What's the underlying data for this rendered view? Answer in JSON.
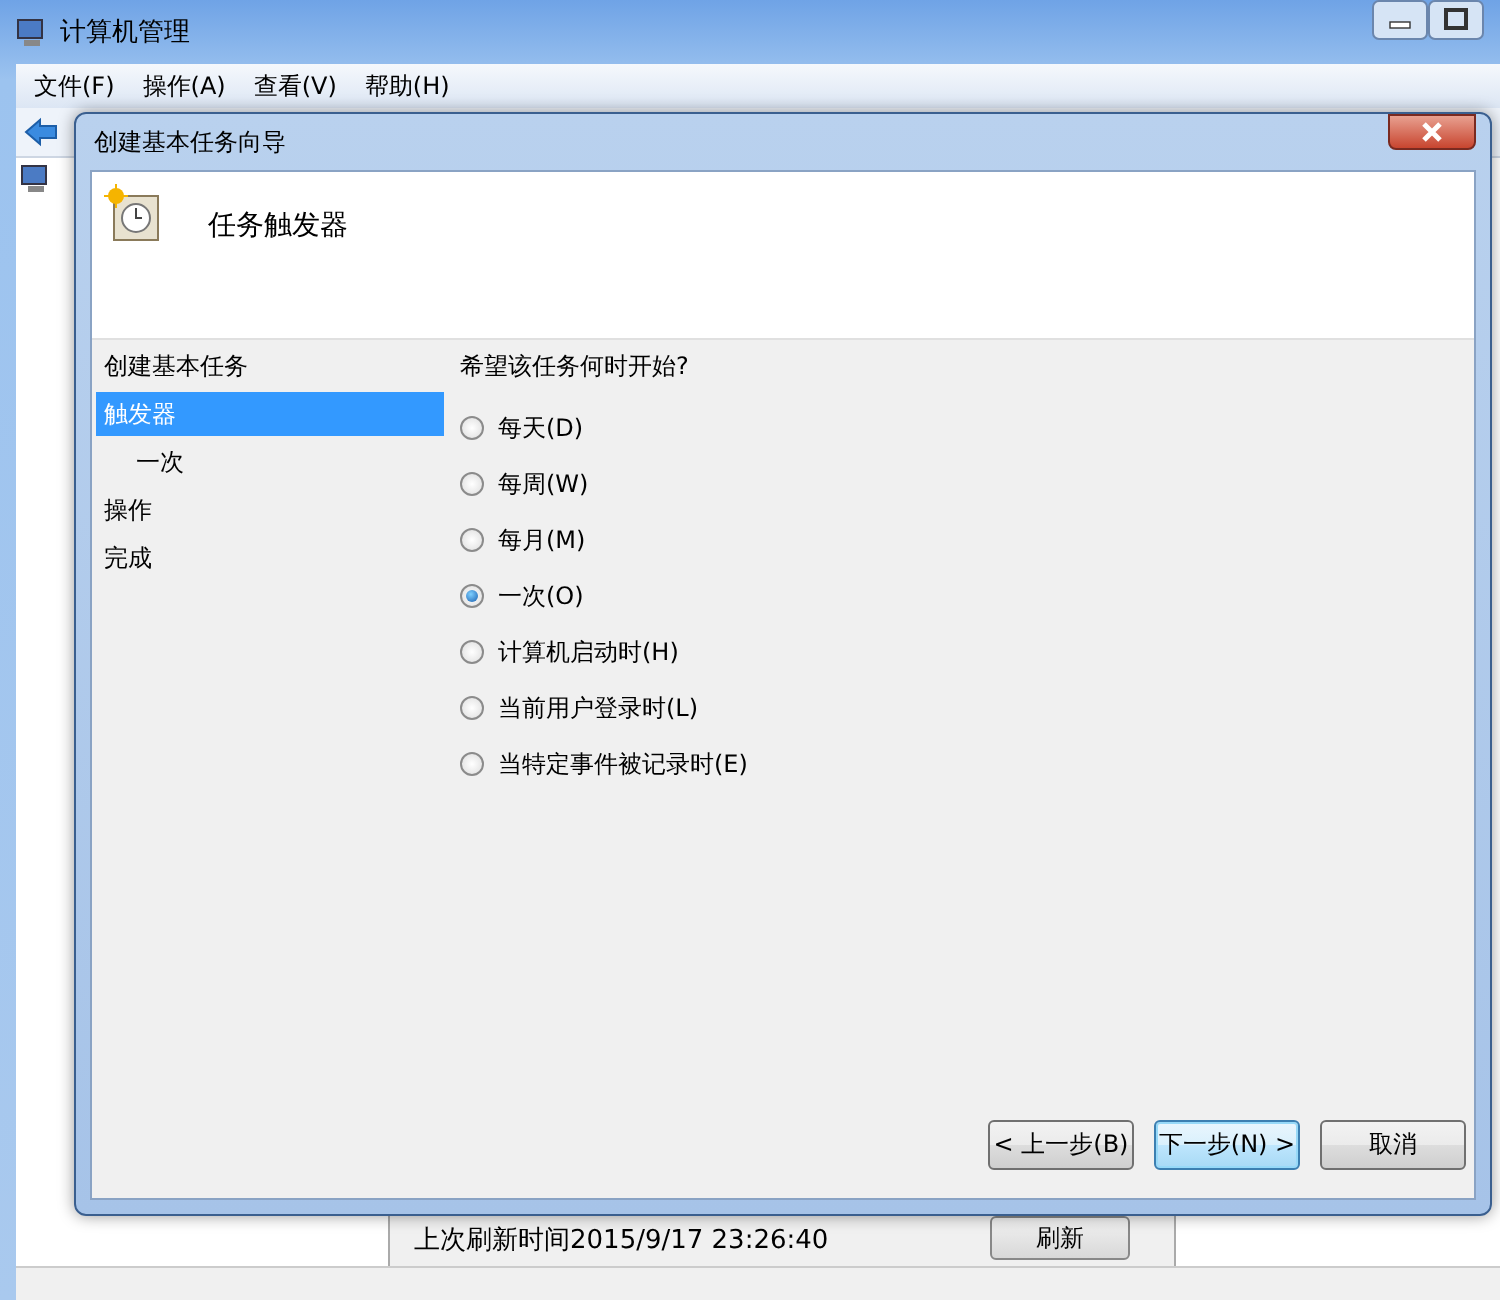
{
  "window": {
    "title": "计算机管理",
    "menu": [
      "文件(F)",
      "操作(A)",
      "查看(V)",
      "帮助(H)"
    ],
    "status_text": "上次刷新时间2015/9/17 23:26:40",
    "refresh_button": "刷新"
  },
  "dialog": {
    "title": "创建基本任务向导",
    "header": "任务触发器",
    "steps": [
      {
        "label": "创建基本任务",
        "selected": false
      },
      {
        "label": "触发器",
        "selected": true,
        "children": [
          {
            "label": "一次",
            "selected": false
          }
        ]
      },
      {
        "label": "操作",
        "selected": false
      },
      {
        "label": "完成",
        "selected": false
      }
    ],
    "question": "希望该任务何时开始?",
    "options": [
      {
        "label": "每天(D)",
        "selected": false
      },
      {
        "label": "每周(W)",
        "selected": false
      },
      {
        "label": "每月(M)",
        "selected": false
      },
      {
        "label": "一次(O)",
        "selected": true
      },
      {
        "label": "计算机启动时(H)",
        "selected": false
      },
      {
        "label": "当前用户登录时(L)",
        "selected": false
      },
      {
        "label": "当特定事件被记录时(E)",
        "selected": false
      }
    ],
    "buttons": [
      {
        "label": "< 上一步(B)",
        "focused": false
      },
      {
        "label": "下一步(N) >",
        "focused": true
      },
      {
        "label": "取消",
        "focused": false
      }
    ]
  }
}
